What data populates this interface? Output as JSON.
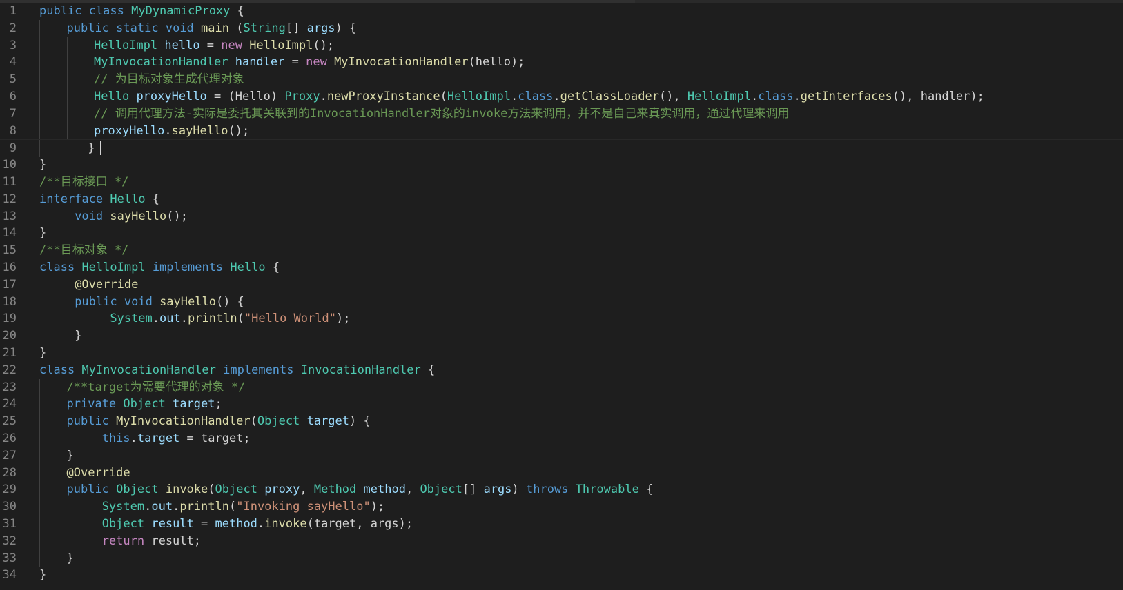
{
  "editor": {
    "language": "java",
    "cursor_line": 9,
    "theme": {
      "background": "#1e1e1e",
      "line_number": "#858585",
      "keyword": "#569cd6",
      "control": "#c586c0",
      "type": "#4ec9b0",
      "variable": "#9cdcfe",
      "function": "#dcdcaa",
      "string": "#ce9178",
      "comment": "#6a9955",
      "default": "#d4d4d4"
    },
    "lines": [
      {
        "n": "1",
        "indent": 0,
        "tokens": [
          [
            "k",
            "public"
          ],
          [
            "d",
            " "
          ],
          [
            "k",
            "class"
          ],
          [
            "d",
            " "
          ],
          [
            "t",
            "MyDynamicProxy"
          ],
          [
            "d",
            " {"
          ]
        ]
      },
      {
        "n": "2",
        "indent": 1,
        "tokens": [
          [
            "k",
            "public"
          ],
          [
            "d",
            " "
          ],
          [
            "k",
            "static"
          ],
          [
            "d",
            " "
          ],
          [
            "k",
            "void"
          ],
          [
            "d",
            " "
          ],
          [
            "f",
            "main"
          ],
          [
            "d",
            " ("
          ],
          [
            "t",
            "String"
          ],
          [
            "d",
            "[] "
          ],
          [
            "v",
            "args"
          ],
          [
            "d",
            ") {"
          ]
        ]
      },
      {
        "n": "3",
        "indent": 2,
        "tokens": [
          [
            "t",
            "HelloImpl"
          ],
          [
            "d",
            " "
          ],
          [
            "v",
            "hello"
          ],
          [
            "d",
            " = "
          ],
          [
            "c",
            "new"
          ],
          [
            "d",
            " "
          ],
          [
            "f",
            "HelloImpl"
          ],
          [
            "d",
            "();"
          ]
        ]
      },
      {
        "n": "4",
        "indent": 2,
        "tokens": [
          [
            "t",
            "MyInvocationHandler"
          ],
          [
            "d",
            " "
          ],
          [
            "v",
            "handler"
          ],
          [
            "d",
            " = "
          ],
          [
            "c",
            "new"
          ],
          [
            "d",
            " "
          ],
          [
            "f",
            "MyInvocationHandler"
          ],
          [
            "d",
            "(hello);"
          ]
        ]
      },
      {
        "n": "5",
        "indent": 2,
        "tokens": [
          [
            "cm",
            "// 为目标对象生成代理对象"
          ]
        ]
      },
      {
        "n": "6",
        "indent": 2,
        "tokens": [
          [
            "t",
            "Hello"
          ],
          [
            "d",
            " "
          ],
          [
            "v",
            "proxyHello"
          ],
          [
            "d",
            " = (Hello) "
          ],
          [
            "t",
            "Proxy"
          ],
          [
            "d",
            "."
          ],
          [
            "f",
            "newProxyInstance"
          ],
          [
            "d",
            "("
          ],
          [
            "t",
            "HelloImpl"
          ],
          [
            "d",
            "."
          ],
          [
            "k",
            "class"
          ],
          [
            "d",
            "."
          ],
          [
            "f",
            "getClassLoader"
          ],
          [
            "d",
            "(), "
          ],
          [
            "t",
            "HelloImpl"
          ],
          [
            "d",
            "."
          ],
          [
            "k",
            "class"
          ],
          [
            "d",
            "."
          ],
          [
            "f",
            "getInterfaces"
          ],
          [
            "d",
            "(), handler);"
          ]
        ]
      },
      {
        "n": "7",
        "indent": 2,
        "tokens": [
          [
            "cm",
            "// 调用代理方法-实际是委托其关联到的InvocationHandler对象的invoke方法来调用，并不是自己来真实调用，通过代理来调用"
          ]
        ]
      },
      {
        "n": "8",
        "indent": 2,
        "tokens": [
          [
            "v",
            "proxyHello"
          ],
          [
            "d",
            "."
          ],
          [
            "f",
            "sayHello"
          ],
          [
            "d",
            "();"
          ]
        ]
      },
      {
        "n": "9",
        "indent": 1,
        "tokens": [
          [
            "d",
            "   }"
          ]
        ],
        "cursor": true
      },
      {
        "n": "10",
        "indent": 0,
        "tokens": [
          [
            "d",
            "}"
          ]
        ]
      },
      {
        "n": "11",
        "indent": 0,
        "tokens": [
          [
            "cm",
            "/**目标接口 */"
          ]
        ]
      },
      {
        "n": "12",
        "indent": 0,
        "tokens": [
          [
            "k",
            "interface"
          ],
          [
            "d",
            " "
          ],
          [
            "t",
            "Hello"
          ],
          [
            "d",
            " {"
          ]
        ]
      },
      {
        "n": "13",
        "indent": 0,
        "tokens": [
          [
            "d",
            "     "
          ],
          [
            "k",
            "void"
          ],
          [
            "d",
            " "
          ],
          [
            "f",
            "sayHello"
          ],
          [
            "d",
            "();"
          ]
        ]
      },
      {
        "n": "14",
        "indent": 0,
        "tokens": [
          [
            "d",
            "}"
          ]
        ]
      },
      {
        "n": "15",
        "indent": 0,
        "tokens": [
          [
            "cm",
            "/**目标对象 */"
          ]
        ]
      },
      {
        "n": "16",
        "indent": 0,
        "tokens": [
          [
            "k",
            "class"
          ],
          [
            "d",
            " "
          ],
          [
            "t",
            "HelloImpl"
          ],
          [
            "d",
            " "
          ],
          [
            "k",
            "implements"
          ],
          [
            "d",
            " "
          ],
          [
            "t",
            "Hello"
          ],
          [
            "d",
            " {"
          ]
        ]
      },
      {
        "n": "17",
        "indent": 0,
        "tokens": [
          [
            "d",
            "     "
          ],
          [
            "f",
            "@Override"
          ]
        ]
      },
      {
        "n": "18",
        "indent": 0,
        "tokens": [
          [
            "d",
            "     "
          ],
          [
            "k",
            "public"
          ],
          [
            "d",
            " "
          ],
          [
            "k",
            "void"
          ],
          [
            "d",
            " "
          ],
          [
            "f",
            "sayHello"
          ],
          [
            "d",
            "() {"
          ]
        ]
      },
      {
        "n": "19",
        "indent": 0,
        "tokens": [
          [
            "d",
            "          "
          ],
          [
            "t",
            "System"
          ],
          [
            "d",
            "."
          ],
          [
            "v",
            "out"
          ],
          [
            "d",
            "."
          ],
          [
            "f",
            "println"
          ],
          [
            "d",
            "("
          ],
          [
            "s",
            "\"Hello World\""
          ],
          [
            "d",
            ");"
          ]
        ]
      },
      {
        "n": "20",
        "indent": 0,
        "tokens": [
          [
            "d",
            "     }"
          ]
        ]
      },
      {
        "n": "21",
        "indent": 0,
        "tokens": [
          [
            "d",
            "}"
          ]
        ]
      },
      {
        "n": "22",
        "indent": 0,
        "tokens": [
          [
            "k",
            "class"
          ],
          [
            "d",
            " "
          ],
          [
            "t",
            "MyInvocationHandler"
          ],
          [
            "d",
            " "
          ],
          [
            "k",
            "implements"
          ],
          [
            "d",
            " "
          ],
          [
            "t",
            "InvocationHandler"
          ],
          [
            "d",
            " {"
          ]
        ]
      },
      {
        "n": "23",
        "indent": 1,
        "tokens": [
          [
            "cm",
            "/**target为需要代理的对象 */"
          ]
        ]
      },
      {
        "n": "24",
        "indent": 1,
        "tokens": [
          [
            "k",
            "private"
          ],
          [
            "d",
            " "
          ],
          [
            "t",
            "Object"
          ],
          [
            "d",
            " "
          ],
          [
            "v",
            "target"
          ],
          [
            "d",
            ";"
          ]
        ]
      },
      {
        "n": "25",
        "indent": 1,
        "tokens": [
          [
            "k",
            "public"
          ],
          [
            "d",
            " "
          ],
          [
            "f",
            "MyInvocationHandler"
          ],
          [
            "d",
            "("
          ],
          [
            "t",
            "Object"
          ],
          [
            "d",
            " "
          ],
          [
            "v",
            "target"
          ],
          [
            "d",
            ") {"
          ]
        ]
      },
      {
        "n": "26",
        "indent": 1,
        "tokens": [
          [
            "d",
            "     "
          ],
          [
            "k",
            "this"
          ],
          [
            "d",
            "."
          ],
          [
            "v",
            "target"
          ],
          [
            "d",
            " = target;"
          ]
        ]
      },
      {
        "n": "27",
        "indent": 1,
        "tokens": [
          [
            "d",
            "}"
          ]
        ]
      },
      {
        "n": "28",
        "indent": 1,
        "tokens": [
          [
            "f",
            "@Override"
          ]
        ]
      },
      {
        "n": "29",
        "indent": 1,
        "tokens": [
          [
            "k",
            "public"
          ],
          [
            "d",
            " "
          ],
          [
            "t",
            "Object"
          ],
          [
            "d",
            " "
          ],
          [
            "f",
            "invoke"
          ],
          [
            "d",
            "("
          ],
          [
            "t",
            "Object"
          ],
          [
            "d",
            " "
          ],
          [
            "v",
            "proxy"
          ],
          [
            "d",
            ", "
          ],
          [
            "t",
            "Method"
          ],
          [
            "d",
            " "
          ],
          [
            "v",
            "method"
          ],
          [
            "d",
            ", "
          ],
          [
            "t",
            "Object"
          ],
          [
            "d",
            "[] "
          ],
          [
            "v",
            "args"
          ],
          [
            "d",
            ") "
          ],
          [
            "k",
            "throws"
          ],
          [
            "d",
            " "
          ],
          [
            "t",
            "Throwable"
          ],
          [
            "d",
            " {"
          ]
        ]
      },
      {
        "n": "30",
        "indent": 1,
        "tokens": [
          [
            "d",
            "     "
          ],
          [
            "t",
            "System"
          ],
          [
            "d",
            "."
          ],
          [
            "v",
            "out"
          ],
          [
            "d",
            "."
          ],
          [
            "f",
            "println"
          ],
          [
            "d",
            "("
          ],
          [
            "s",
            "\"Invoking sayHello\""
          ],
          [
            "d",
            ");"
          ]
        ]
      },
      {
        "n": "31",
        "indent": 1,
        "tokens": [
          [
            "d",
            "     "
          ],
          [
            "t",
            "Object"
          ],
          [
            "d",
            " "
          ],
          [
            "v",
            "result"
          ],
          [
            "d",
            " = "
          ],
          [
            "v",
            "method"
          ],
          [
            "d",
            "."
          ],
          [
            "f",
            "invoke"
          ],
          [
            "d",
            "(target, args);"
          ]
        ]
      },
      {
        "n": "32",
        "indent": 1,
        "tokens": [
          [
            "d",
            "     "
          ],
          [
            "c",
            "return"
          ],
          [
            "d",
            " result;"
          ]
        ]
      },
      {
        "n": "33",
        "indent": 1,
        "tokens": [
          [
            "d",
            "}"
          ]
        ]
      },
      {
        "n": "34",
        "indent": 0,
        "tokens": [
          [
            "d",
            "}"
          ]
        ]
      }
    ]
  }
}
